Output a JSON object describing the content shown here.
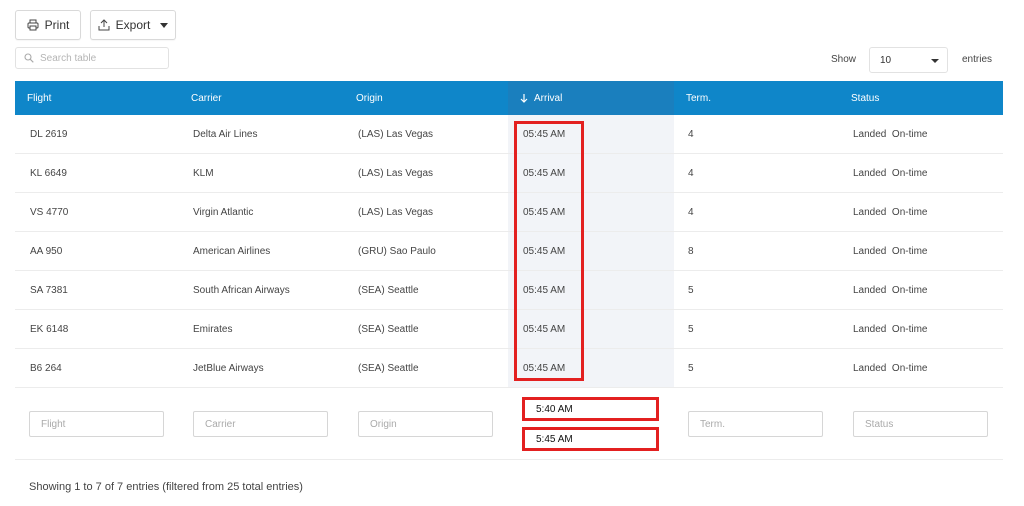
{
  "toolbar": {
    "print_label": "Print",
    "export_label": "Export"
  },
  "search": {
    "placeholder": "Search table"
  },
  "length_menu": {
    "show_label": "Show",
    "selected": "10",
    "entries_label": "entries"
  },
  "columns": [
    "Flight",
    "Carrier",
    "Origin",
    "Arrival",
    "Term.",
    "Status"
  ],
  "sorted_column": "Arrival",
  "rows": [
    {
      "flight": "DL 2619",
      "carrier": "Delta Air Lines",
      "origin": "(LAS) Las Vegas",
      "arrival": "05:45 AM",
      "term": "4",
      "status": "Landed  On-time"
    },
    {
      "flight": "KL 6649",
      "carrier": "KLM",
      "origin": "(LAS) Las Vegas",
      "arrival": "05:45 AM",
      "term": "4",
      "status": "Landed  On-time"
    },
    {
      "flight": "VS 4770",
      "carrier": "Virgin Atlantic",
      "origin": "(LAS) Las Vegas",
      "arrival": "05:45 AM",
      "term": "4",
      "status": "Landed  On-time"
    },
    {
      "flight": "AA 950",
      "carrier": "American Airlines",
      "origin": "(GRU) Sao Paulo",
      "arrival": "05:45 AM",
      "term": "8",
      "status": "Landed  On-time"
    },
    {
      "flight": "SA 7381",
      "carrier": "South African Airways",
      "origin": "(SEA) Seattle",
      "arrival": "05:45 AM",
      "term": "5",
      "status": "Landed  On-time"
    },
    {
      "flight": "EK 6148",
      "carrier": "Emirates",
      "origin": "(SEA) Seattle",
      "arrival": "05:45 AM",
      "term": "5",
      "status": "Landed  On-time"
    },
    {
      "flight": "B6 264",
      "carrier": "JetBlue Airways",
      "origin": "(SEA) Seattle",
      "arrival": "05:45 AM",
      "term": "5",
      "status": "Landed  On-time"
    }
  ],
  "filters": {
    "flight": "Flight",
    "carrier": "Carrier",
    "origin": "Origin",
    "arrival_from": "5:40 AM",
    "arrival_to": "5:45 AM",
    "term": "Term.",
    "status": "Status"
  },
  "info": "Showing 1 to 7 of 7 entries (filtered from 25 total entries)",
  "colors": {
    "header_bg": "#0f86c9",
    "highlight": "#e32020",
    "sorted_col_bg": "#f2f4f8"
  },
  "icons": {
    "print": "printer-icon",
    "export": "upload-icon",
    "search": "search-icon",
    "sort": "arrow-down-icon"
  }
}
